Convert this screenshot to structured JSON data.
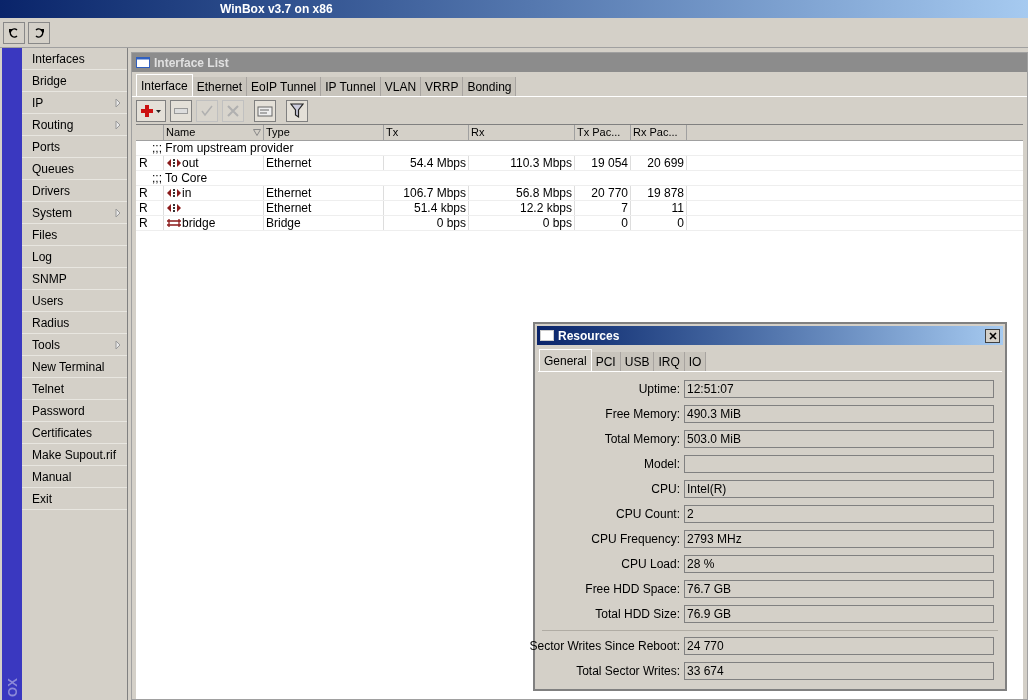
{
  "window": {
    "title": "WinBox v3.7 on x86"
  },
  "sidebar": {
    "brand": "OX",
    "items": [
      {
        "label": "Interfaces",
        "submenu": false
      },
      {
        "label": "Bridge",
        "submenu": false
      },
      {
        "label": "IP",
        "submenu": true
      },
      {
        "label": "Routing",
        "submenu": true
      },
      {
        "label": "Ports",
        "submenu": false
      },
      {
        "label": "Queues",
        "submenu": false
      },
      {
        "label": "Drivers",
        "submenu": false
      },
      {
        "label": "System",
        "submenu": true
      },
      {
        "label": "Files",
        "submenu": false
      },
      {
        "label": "Log",
        "submenu": false
      },
      {
        "label": "SNMP",
        "submenu": false
      },
      {
        "label": "Users",
        "submenu": false
      },
      {
        "label": "Radius",
        "submenu": false
      },
      {
        "label": "Tools",
        "submenu": true
      },
      {
        "label": "New Terminal",
        "submenu": false
      },
      {
        "label": "Telnet",
        "submenu": false
      },
      {
        "label": "Password",
        "submenu": false
      },
      {
        "label": "Certificates",
        "submenu": false
      },
      {
        "label": "Make Supout.rif",
        "submenu": false
      },
      {
        "label": "Manual",
        "submenu": false
      },
      {
        "label": "Exit",
        "submenu": false
      }
    ]
  },
  "interface_list": {
    "title": "Interface List",
    "tabs": [
      {
        "label": "Interface",
        "selected": true
      },
      {
        "label": "Ethernet",
        "selected": false
      },
      {
        "label": "EoIP Tunnel",
        "selected": false
      },
      {
        "label": "IP Tunnel",
        "selected": false
      },
      {
        "label": "VLAN",
        "selected": false
      },
      {
        "label": "VRRP",
        "selected": false
      },
      {
        "label": "Bonding",
        "selected": false
      }
    ],
    "toolbar": [
      {
        "kind": "add",
        "disabled": false
      },
      {
        "kind": "remove",
        "disabled": false
      },
      {
        "kind": "enable",
        "disabled": true
      },
      {
        "kind": "disable",
        "disabled": true
      },
      {
        "kind": "comment",
        "disabled": false
      },
      {
        "kind": "filter",
        "disabled": false
      }
    ],
    "columns": [
      "Name",
      "Type",
      "Tx",
      "Rx",
      "Tx Pac...",
      "Rx Pac..."
    ],
    "rows": [
      {
        "kind": "comment",
        "text": ";;; From  upstream provider"
      },
      {
        "kind": "ethernet",
        "flag": "R",
        "name": "out",
        "type": "Ethernet",
        "tx": "54.4 Mbps",
        "rx": "110.3 Mbps",
        "tx_packets": "19 054",
        "rx_packets": "20 699"
      },
      {
        "kind": "comment",
        "text": ";;; To Core"
      },
      {
        "kind": "ethernet",
        "flag": "R",
        "name": "in",
        "type": "Ethernet",
        "tx": "106.7 Mbps",
        "rx": "56.8 Mbps",
        "tx_packets": "20 770",
        "rx_packets": "19 878"
      },
      {
        "kind": "ethernet",
        "flag": "R",
        "type": "Ethernet",
        "tx": "51.4 kbps",
        "rx": "12.2 kbps",
        "tx_packets": "7",
        "rx_packets": "11"
      },
      {
        "kind": "bridge",
        "flag": "R",
        "name": "bridge",
        "type": "Bridge",
        "tx": "0 bps",
        "rx": "0 bps",
        "tx_packets": "0",
        "rx_packets": "0"
      }
    ]
  },
  "resources": {
    "title": "Resources",
    "tabs": [
      {
        "label": "General",
        "selected": true
      },
      {
        "label": "PCI",
        "selected": false
      },
      {
        "label": "USB",
        "selected": false
      },
      {
        "label": "IRQ",
        "selected": false
      },
      {
        "label": "IO",
        "selected": false
      }
    ],
    "fields": [
      {
        "label": "Uptime:",
        "value": "12:51:07"
      },
      {
        "label": "Free Memory:",
        "value": "490.3 MiB"
      },
      {
        "label": "Total Memory:",
        "value": "503.0 MiB"
      },
      {
        "label": "Model:"
      },
      {
        "label": "CPU:",
        "value": "Intel(R)"
      },
      {
        "label": "CPU Count:",
        "value": "2"
      },
      {
        "label": "CPU Frequency:",
        "value": "2793 MHz"
      },
      {
        "label": "CPU Load:",
        "value": "28 %"
      },
      {
        "label": "Free HDD Space:",
        "value": "76.7 GB"
      },
      {
        "label": "Total HDD Size:",
        "value": "76.9 GB"
      }
    ],
    "sector_fields": [
      {
        "label": "Sector Writes Since Reboot:",
        "value": "24 770"
      },
      {
        "label": "Total Sector Writes:",
        "value": "33 674"
      }
    ]
  }
}
